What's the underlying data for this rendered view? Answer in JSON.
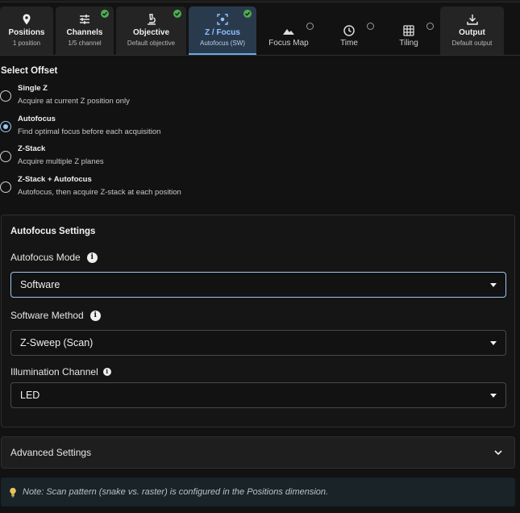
{
  "tabs": [
    {
      "label": "Positions",
      "sub": "1 position",
      "icon": "pin-icon",
      "status": "none"
    },
    {
      "label": "Channels",
      "sub": "1/5 channel",
      "icon": "sliders-icon",
      "status": "done"
    },
    {
      "label": "Objective",
      "sub": "Default objective",
      "icon": "microscope-icon",
      "status": "done"
    },
    {
      "label": "Z / Focus",
      "sub": "Autofocus (SW)",
      "icon": "focus-icon",
      "status": "done"
    },
    {
      "label": "Focus Map",
      "sub": "",
      "icon": "mountain-icon",
      "status": "pending"
    },
    {
      "label": "Time",
      "sub": "",
      "icon": "clock-icon",
      "status": "pending"
    },
    {
      "label": "Tiling",
      "sub": "",
      "icon": "grid-icon",
      "status": "pending"
    },
    {
      "label": "Output",
      "sub": "Default output",
      "icon": "download-icon",
      "status": "none"
    }
  ],
  "offset": {
    "title": "Select Offset",
    "selected": "Autofocus",
    "options": [
      {
        "label": "Single Z",
        "desc": "Acquire at current Z position only"
      },
      {
        "label": "Autofocus",
        "desc": "Find optimal focus before each acquisition"
      },
      {
        "label": "Z-Stack",
        "desc": "Acquire multiple Z planes"
      },
      {
        "label": "Z-Stack + Autofocus",
        "desc": "Autofocus, then acquire Z-stack at each position"
      }
    ]
  },
  "autofocus": {
    "title": "Autofocus Settings",
    "mode_label": "Autofocus Mode",
    "mode_value": "Software",
    "method_label": "Software Method",
    "method_value": "Z-Sweep (Scan)",
    "illum_label": "Illumination Channel",
    "illum_value": "LED"
  },
  "advanced": {
    "label": "Advanced Settings"
  },
  "note": {
    "text": "Note: Scan pattern (snake vs. raster) is configured in the Positions dimension."
  },
  "colors": {
    "accent": "#9cc7f3",
    "active_tab_bg": "#2a3a4d",
    "done": "#4caf50",
    "background": "#121212"
  }
}
